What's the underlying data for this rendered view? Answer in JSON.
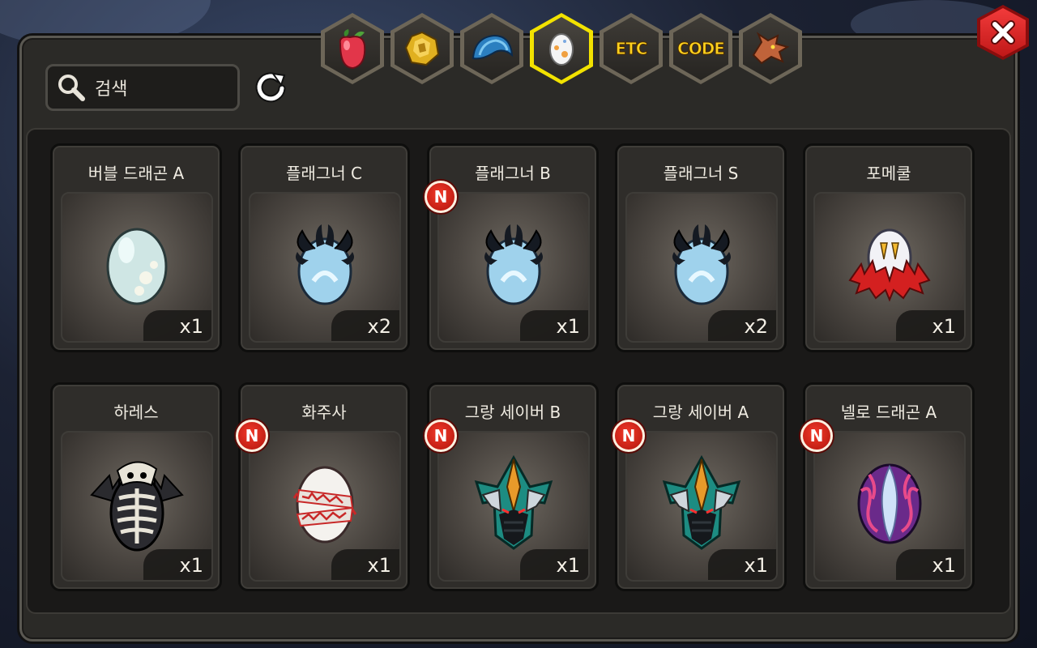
{
  "search": {
    "placeholder": "검색"
  },
  "tabs": [
    {
      "name": "fruit",
      "icon": "red-fruit-icon",
      "label": ""
    },
    {
      "name": "ore",
      "icon": "gold-ore-icon",
      "label": ""
    },
    {
      "name": "scale",
      "icon": "blue-scale-icon",
      "label": ""
    },
    {
      "name": "egg",
      "icon": "egg-icon",
      "label": "",
      "active": true
    },
    {
      "name": "etc",
      "icon": "",
      "label": "ETC"
    },
    {
      "name": "code",
      "icon": "",
      "label": "CODE"
    },
    {
      "name": "dragon",
      "icon": "dragon-head-icon",
      "label": ""
    }
  ],
  "items": [
    {
      "name": "버블 드래곤 A",
      "qty": "x1",
      "new": false,
      "icon": "speckled-white-egg"
    },
    {
      "name": "플래그너 C",
      "qty": "x2",
      "new": false,
      "icon": "horned-blue-egg"
    },
    {
      "name": "플래그너 B",
      "qty": "x1",
      "new": true,
      "icon": "horned-blue-egg"
    },
    {
      "name": "플래그너 S",
      "qty": "x2",
      "new": false,
      "icon": "horned-blue-egg"
    },
    {
      "name": "포메쿨",
      "qty": "x1",
      "new": false,
      "icon": "white-egg-red-fur"
    },
    {
      "name": "하레스",
      "qty": "x1",
      "new": false,
      "icon": "skeleton-wing-egg"
    },
    {
      "name": "화주사",
      "qty": "x1",
      "new": true,
      "icon": "bandaged-egg"
    },
    {
      "name": "그랑 세이버 B",
      "qty": "x1",
      "new": true,
      "icon": "armored-teal-egg"
    },
    {
      "name": "그랑 세이버 A",
      "qty": "x1",
      "new": true,
      "icon": "armored-teal-egg"
    },
    {
      "name": "넬로 드래곤 A",
      "qty": "x1",
      "new": true,
      "icon": "purple-crystal-egg"
    }
  ],
  "badge_text": "N",
  "colors": {
    "active_tab": "#f2e200",
    "badge": "#d42016",
    "code_text": "#ffd21e"
  }
}
